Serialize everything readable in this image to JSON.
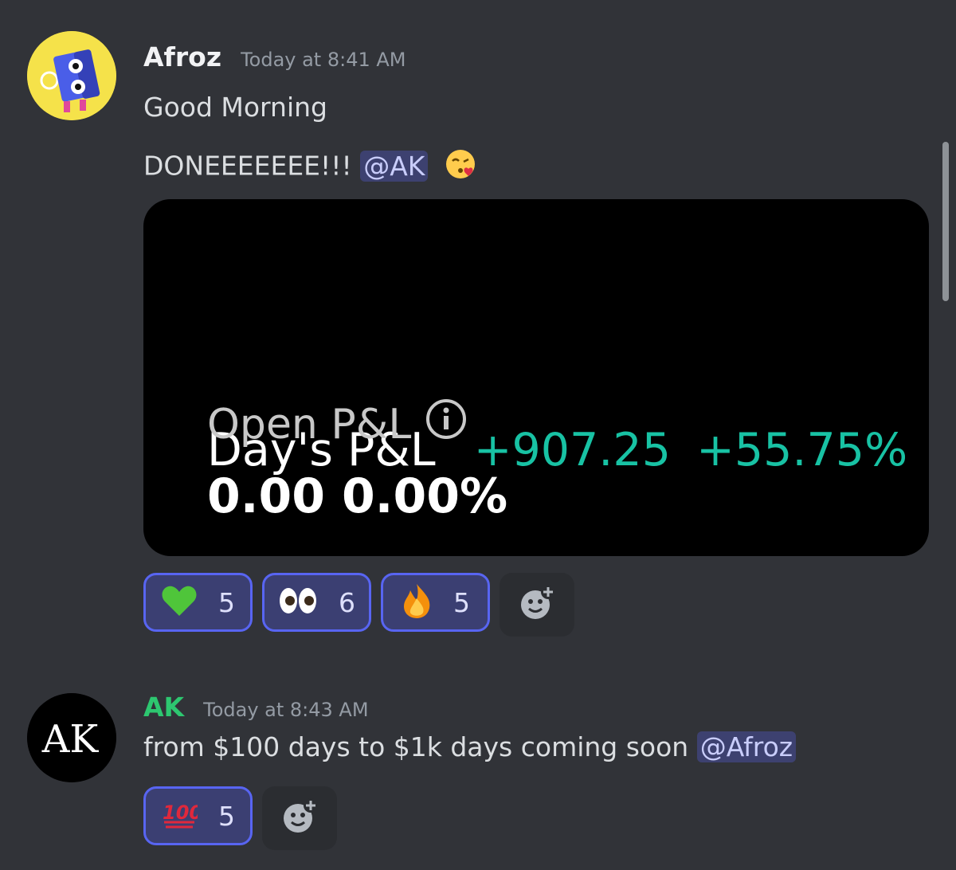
{
  "colors": {
    "background": "#313338",
    "afroz_name": "#f2f3f5",
    "ak_name": "#2dc770",
    "pnl_positive": "#18c2a4",
    "mention_bg": "#3c4270",
    "reaction_border": "#5865f2"
  },
  "messages": [
    {
      "username": "Afroz",
      "timestamp": "Today at 8:41 AM",
      "avatar_icon": "speaker-robot-avatar",
      "lines": [
        {
          "text": "Good Morning"
        },
        {
          "text": "DONEEEEEEE!!!",
          "mention": "@AK",
          "emoji": "face-blowing-kiss"
        }
      ],
      "embed": {
        "days_pnl_label": "Day's P&L",
        "days_pnl_value": "+907.25",
        "days_pnl_percent": "+55.75%",
        "open_pnl_label": "Open P&L",
        "open_pnl_info_icon": "info-icon",
        "open_pnl_value": "0.00",
        "open_pnl_percent": "0.00%"
      },
      "reactions": [
        {
          "emoji": "green-heart",
          "count": "5"
        },
        {
          "emoji": "eyes",
          "count": "6"
        },
        {
          "emoji": "fire",
          "count": "5"
        }
      ]
    },
    {
      "username": "AK",
      "timestamp": "Today at 8:43 AM",
      "avatar_icon": "ak-logo-avatar",
      "avatar_letters": "AK",
      "text": "from $100 days to $1k days coming soon",
      "mention": "@Afroz",
      "reactions": [
        {
          "emoji": "hundred-points",
          "count": "5"
        }
      ]
    }
  ]
}
